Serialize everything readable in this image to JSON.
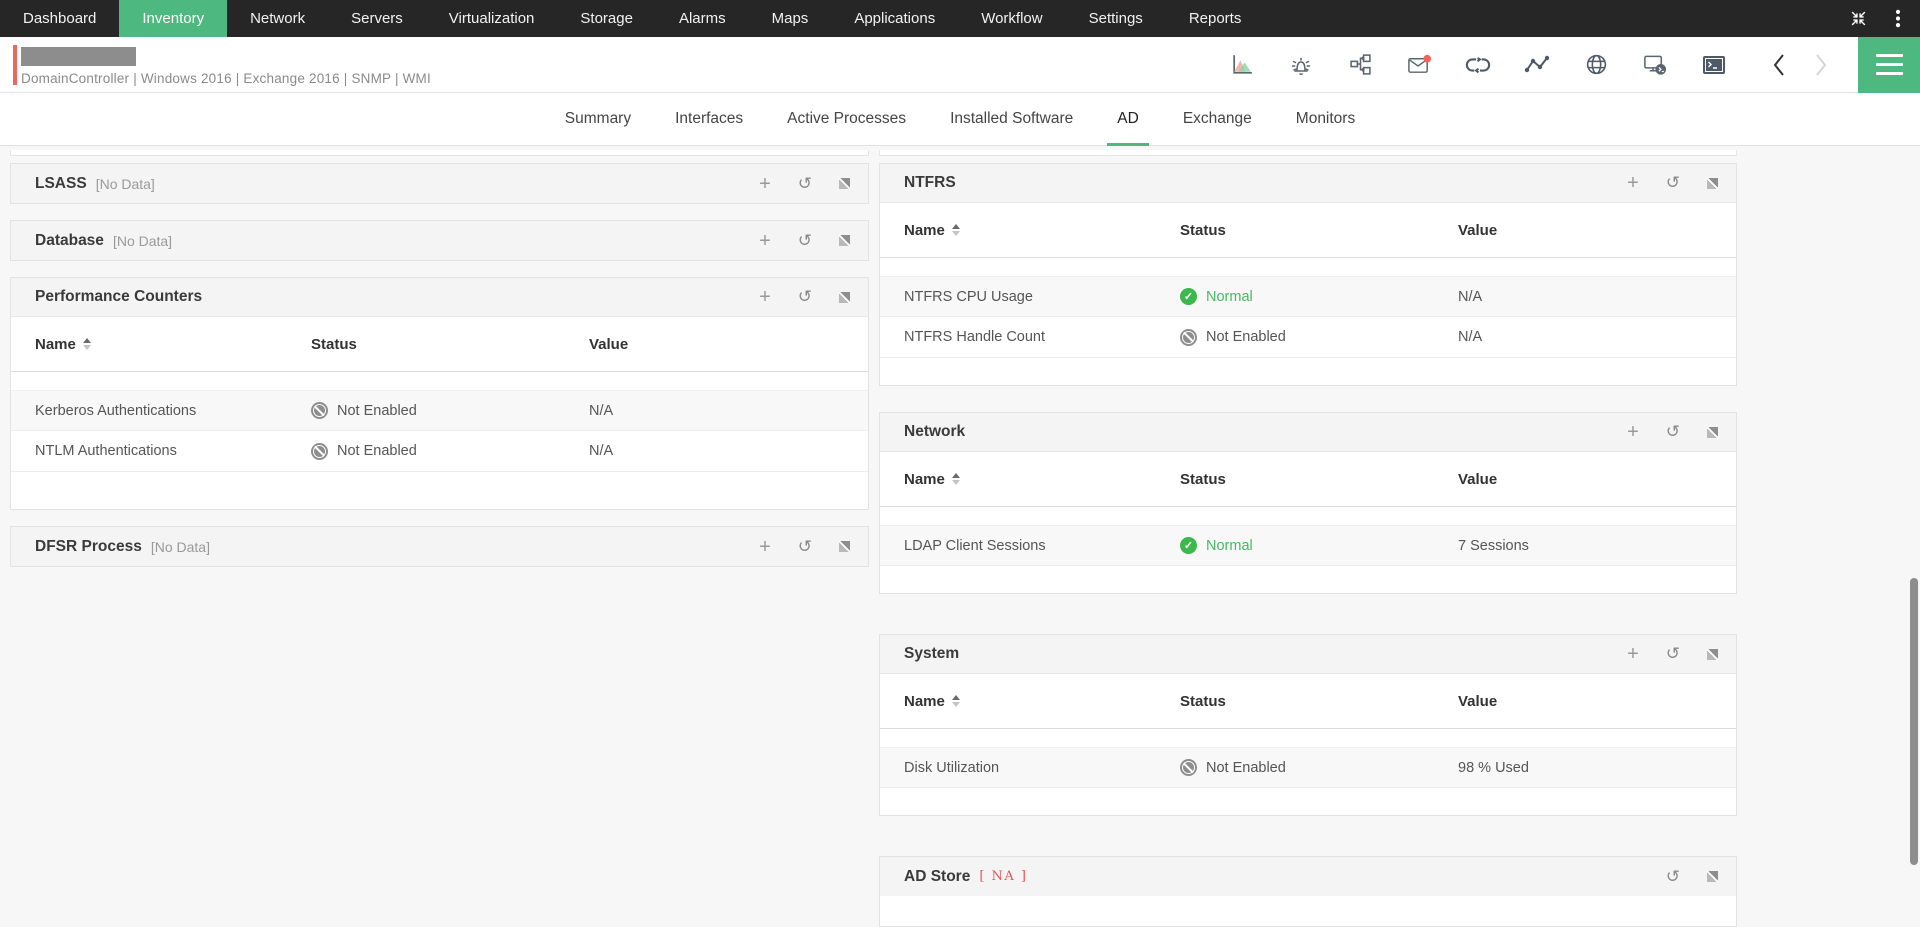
{
  "colors": {
    "accent_green": "#4db87f",
    "status_green": "#3cb84c",
    "status_green_text": "#45ba61",
    "na_red": "#e25757",
    "notification_red": "#f4645a",
    "nav_background": "#262626"
  },
  "icons": {
    "add_glyph": "+",
    "refresh_glyph": "↺",
    "check_glyph": "✓"
  },
  "nav": {
    "active_item": "Inventory",
    "items": [
      "Dashboard",
      "Inventory",
      "Network",
      "Servers",
      "Virtualization",
      "Storage",
      "Alarms",
      "Maps",
      "Applications",
      "Workflow",
      "Settings",
      "Reports"
    ]
  },
  "device_bar": {
    "subtitle": "DomainController | Windows 2016  | Exchange 2016  | SNMP  | WMI",
    "subtitle_parts": [
      "DomainController",
      "Windows 2016",
      "Exchange 2016",
      "SNMP",
      "WMI"
    ]
  },
  "tabs": {
    "active": "AD",
    "items": [
      "Summary",
      "Interfaces",
      "Active Processes",
      "Installed Software",
      "AD",
      "Exchange",
      "Monitors"
    ]
  },
  "table_columns": {
    "name": "Name",
    "status": "Status",
    "value": "Value"
  },
  "left_panels": [
    {
      "title": "LSASS",
      "badge": "[No Data]"
    },
    {
      "title": "Database",
      "badge": "[No Data]"
    },
    {
      "title": "Performance Counters",
      "rows": [
        {
          "name": "Kerberos Authentications",
          "status": "Not Enabled",
          "value": "N/A"
        },
        {
          "name": "NTLM Authentications",
          "status": "Not Enabled",
          "value": "N/A"
        }
      ]
    },
    {
      "title": "DFSR Process",
      "badge": "[No Data]"
    }
  ],
  "right_panels": [
    {
      "title": "NTFRS",
      "rows": [
        {
          "name": "NTFRS CPU Usage",
          "status": "Normal",
          "value": "N/A"
        },
        {
          "name": "NTFRS Handle Count",
          "status": "Not Enabled",
          "value": "N/A"
        }
      ]
    },
    {
      "title": "Network",
      "rows": [
        {
          "name": "LDAP Client Sessions",
          "status": "Normal",
          "value": "7 Sessions"
        }
      ]
    },
    {
      "title": "System",
      "rows": [
        {
          "name": "Disk Utilization",
          "status": "Not Enabled",
          "value": "98 % Used"
        }
      ]
    },
    {
      "title": "AD Store",
      "badge": "[ NA ]"
    }
  ]
}
